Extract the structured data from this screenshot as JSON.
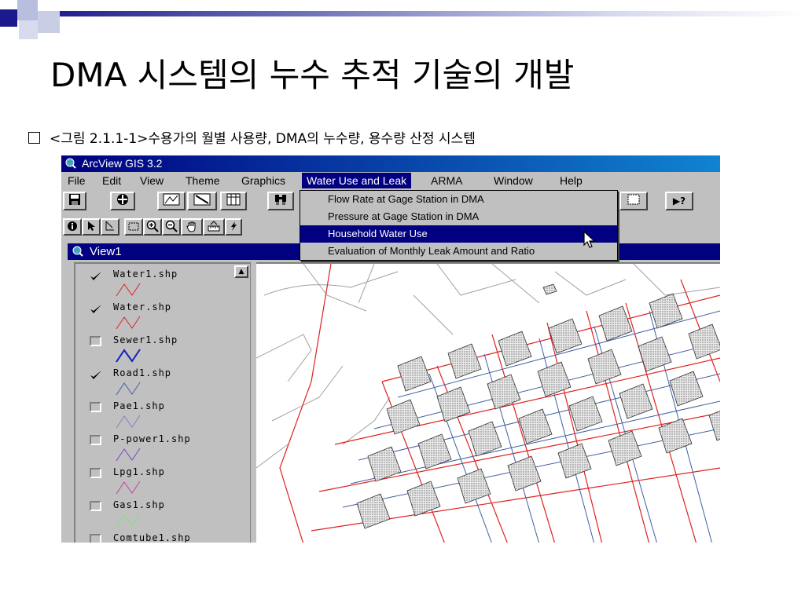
{
  "slide": {
    "title": "DMA 시스템의 누수 추적 기술의 개발",
    "subtitle": "<그림 2.1.1-1>수용가의 월별 사용량, DMA의 누수량, 용수량 산정 시스템",
    "accent_color": "#1a1a8c"
  },
  "app": {
    "title": "ArcView GIS 3.2",
    "menu": [
      {
        "label": "File"
      },
      {
        "label": "Edit"
      },
      {
        "label": "View"
      },
      {
        "label": "Theme"
      },
      {
        "label": "Graphics"
      },
      {
        "label": "Water Use and Leak",
        "active": true
      },
      {
        "label": "ARMA"
      },
      {
        "label": "Window"
      },
      {
        "label": "Help"
      }
    ],
    "dropdown": [
      {
        "label": "Flow Rate at Gage Station in DMA"
      },
      {
        "label": "Pressure at Gage Station in DMA"
      },
      {
        "label": "Household Water Use",
        "highlighted": true
      },
      {
        "label": "Evaluation of Monthly Leak Amount and Ratio"
      }
    ],
    "toolbar_icons": [
      "save-icon",
      "add-theme-icon",
      "theme-properties-icon",
      "edit-legend-icon",
      "table-icon",
      "find-icon",
      "zoom-extent-icon",
      "help-icon"
    ],
    "tool_icons": [
      "identify-icon",
      "pointer-icon",
      "vertex-icon",
      "select-box-icon",
      "zoom-in-icon",
      "zoom-out-icon",
      "pan-icon",
      "measure-icon",
      "hotlink-icon"
    ],
    "help_button_label": "▶?"
  },
  "view": {
    "title": "View1",
    "layers": [
      {
        "name": "Water1.shp",
        "checked": true,
        "color": "#e02020"
      },
      {
        "name": "Water.shp",
        "checked": true,
        "color": "#e02020"
      },
      {
        "name": "Sewer1.shp",
        "checked": false,
        "color": "#1020c0"
      },
      {
        "name": "Road1.shp",
        "checked": true,
        "color": "#4060a0"
      },
      {
        "name": "Pae1.shp",
        "checked": false,
        "color": "#8080c0"
      },
      {
        "name": "P-power1.shp",
        "checked": false,
        "color": "#8040c0"
      },
      {
        "name": "Lpg1.shp",
        "checked": false,
        "color": "#c040a0"
      },
      {
        "name": "Gas1.shp",
        "checked": false,
        "color": "#80e080"
      },
      {
        "name": "Comtube1.shp",
        "checked": false,
        "color": "#606060"
      }
    ]
  }
}
